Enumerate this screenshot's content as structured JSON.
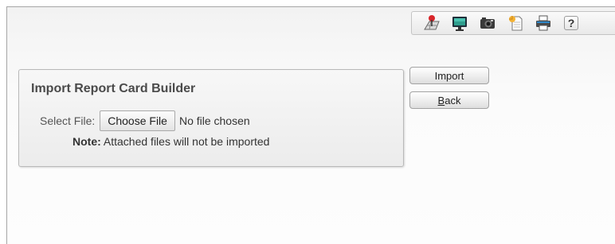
{
  "toolbar": {
    "icons": [
      "map-pin-icon",
      "monitor-icon",
      "camera-icon",
      "page-icon",
      "printer-icon",
      "help-icon"
    ],
    "help_label": "?"
  },
  "panel": {
    "title": "Import Report Card Builder",
    "select_label": "Select File:",
    "choose_button": "Choose File",
    "no_file_text": "No file chosen",
    "note_label": "Note:",
    "note_text": " Attached files will not be imported"
  },
  "actions": {
    "import_label": "Import",
    "back_first": "B",
    "back_rest": "ack"
  }
}
